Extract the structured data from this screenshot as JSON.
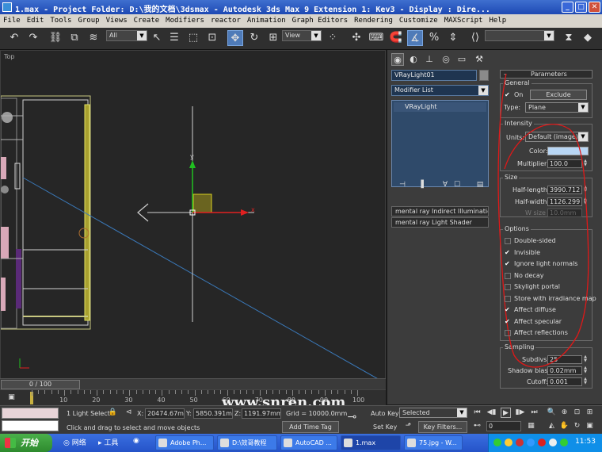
{
  "window": {
    "title": "1.max    - Project Folder: D:\\我的文档\\3dsmax    - Autodesk 3ds Max 9 Extension 1: Kev3    - Display : Dire...",
    "btn_min": "_",
    "btn_max": "□",
    "btn_close": "✕"
  },
  "menu": [
    "File",
    "Edit",
    "Tools",
    "Group",
    "Views",
    "Create",
    "Modifiers",
    "reactor",
    "Animation",
    "Graph Editors",
    "Rendering",
    "Customize",
    "MAXScript",
    "Help"
  ],
  "toolbar": {
    "selection_filter": "All",
    "reference_coord": "View"
  },
  "viewport": {
    "label": "Top",
    "gizmo_x_label": "x",
    "gizmo_y_label": "y"
  },
  "command_panel": {
    "object_name": "VRayLight01",
    "modifier_list": "Modifier List",
    "stack_item": "VRayLight",
    "rollout_mr_indirect": "mental ray Indirect Illumination",
    "rollout_mr_shader": "mental ray Light Shader",
    "parameters_title": "Parameters",
    "general": {
      "label": "General",
      "on_label": "On",
      "exclude_label": "Exclude",
      "type_label": "Type:",
      "type_value": "Plane"
    },
    "intensity": {
      "label": "Intensity",
      "units_label": "Units:",
      "units_value": "Default (image)",
      "color_label": "Color:",
      "multiplier_label": "Multiplier:",
      "multiplier_value": "100.0"
    },
    "size": {
      "label": "Size",
      "half_length_label": "Half-length:",
      "half_length_value": "3990.712",
      "half_width_label": "Half-width:",
      "half_width_value": "1126.299",
      "w_size_label": "W size",
      "w_size_value": "10.0mm"
    },
    "options": {
      "label": "Options",
      "items": [
        {
          "label": "Double-sided",
          "checked": false
        },
        {
          "label": "Invisible",
          "checked": true
        },
        {
          "label": "Ignore light normals",
          "checked": true
        },
        {
          "label": "No decay",
          "checked": false
        },
        {
          "label": "Skylight portal",
          "checked": false
        },
        {
          "label": "Store with irradiance map",
          "checked": false
        },
        {
          "label": "Affect diffuse",
          "checked": true
        },
        {
          "label": "Affect specular",
          "checked": true
        },
        {
          "label": "Affect reflections",
          "checked": false
        }
      ]
    },
    "sampling": {
      "label": "Sampling",
      "subdivs_label": "Subdivs:",
      "subdivs_value": "25",
      "shadow_bias_label": "Shadow bias:",
      "shadow_bias_value": "0.02mm",
      "cutoff_label": "Cutoff:",
      "cutoff_value": "0.001"
    }
  },
  "timeline": {
    "frame_display": "0 / 100",
    "ticks": [
      "10",
      "20",
      "30",
      "40",
      "50",
      "60",
      "70",
      "80",
      "90",
      "100"
    ]
  },
  "watermark": "www.snren.com",
  "status": {
    "selection_info": "1 Light Select",
    "x_label": "X:",
    "x_value": "20474.67m",
    "y_label": "Y:",
    "y_value": "5850.391m",
    "z_label": "Z:",
    "z_value": "1191.97mm",
    "grid": "Grid = 10000.0mm",
    "prompt": "Click and drag to select and move objects",
    "add_time_tag": "Add Time Tag",
    "auto_key": "Auto Key",
    "set_key": "Set Key",
    "selected": "Selected",
    "key_filters": "Key Filters...",
    "frame_value": "0"
  },
  "taskbar": {
    "start": "开始",
    "quicklaunch": [
      "网络",
      "工具"
    ],
    "items": [
      "Adobe Ph...",
      "D:\\效哥教程",
      "AutoCAD ...",
      "1.max",
      "75.jpg - W..."
    ],
    "active_index": 3,
    "clock": "11:53"
  },
  "colors": {
    "light_color": "#b8d6f4",
    "annotation_red": "#e01818",
    "gizmo_yellow": "#d8d020",
    "axis_red": "#e02020",
    "axis_green": "#20c020",
    "wall_pink": "#d8a8b8",
    "beam_blue": "#3a78b8"
  }
}
